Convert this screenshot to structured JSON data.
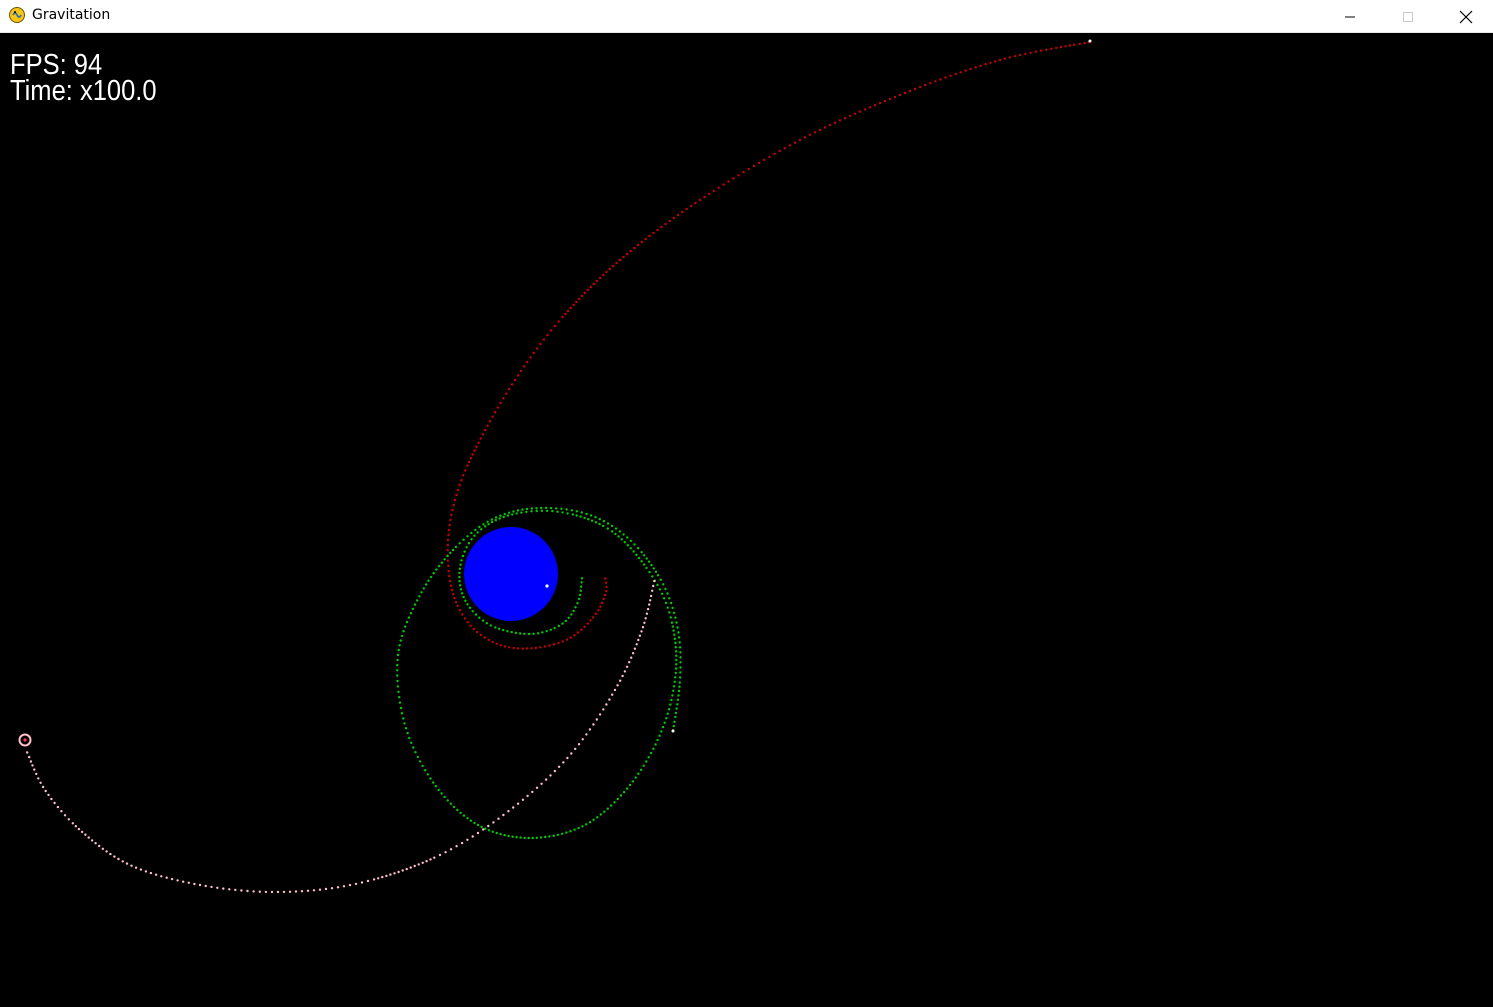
{
  "window": {
    "title": "Gravitation",
    "icon": "pygame-snake-icon",
    "controls": [
      "minimize-icon",
      "maximize-icon",
      "close-icon"
    ]
  },
  "hud": {
    "fps": "FPS: 94",
    "time": "Time: x100.0"
  },
  "scene": {
    "background": "#000000",
    "bodies": [
      {
        "name": "planet",
        "color": "#0000ff"
      },
      {
        "name": "planet-core",
        "color": "#ffffff"
      },
      {
        "name": "probe-pink",
        "color": "#ffc0cb"
      }
    ],
    "trails": [
      {
        "name": "red-trail",
        "color": "#cc0000"
      },
      {
        "name": "green-trail",
        "color": "#00cc00"
      },
      {
        "name": "pink-trail",
        "color": "#ffc0cb"
      }
    ]
  }
}
